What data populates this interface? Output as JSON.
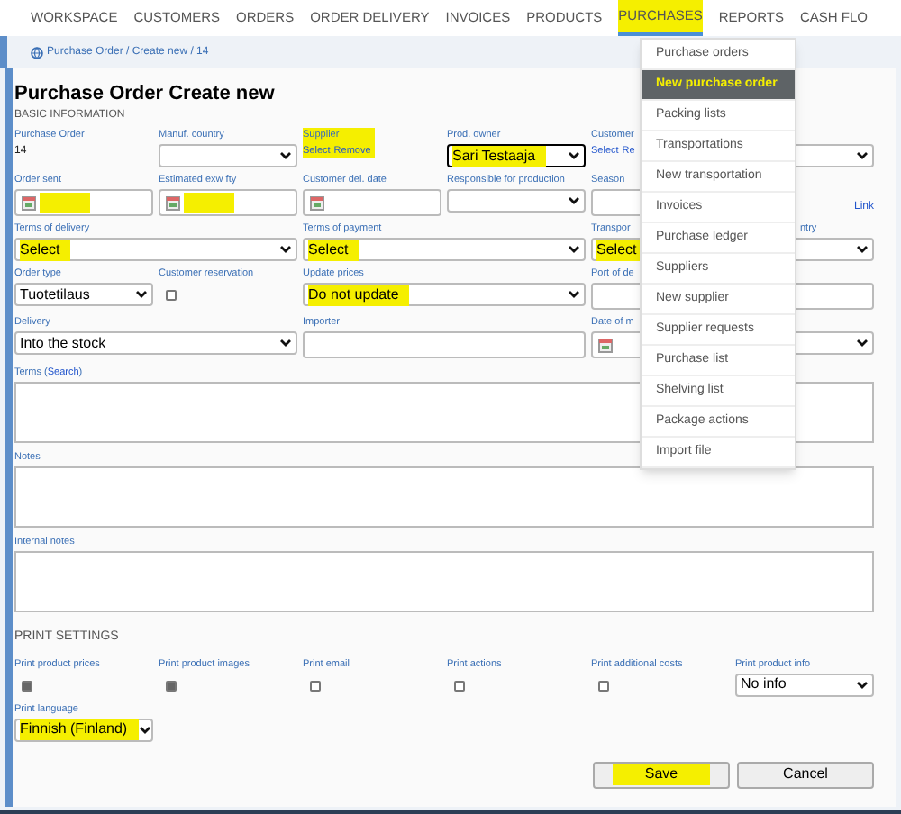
{
  "nav": [
    {
      "label": "WORKSPACE",
      "selected": false,
      "highlighted": false
    },
    {
      "label": "CUSTOMERS",
      "selected": false,
      "highlighted": false
    },
    {
      "label": "ORDERS",
      "selected": false,
      "highlighted": false
    },
    {
      "label": "ORDER DELIVERY",
      "selected": false,
      "highlighted": false
    },
    {
      "label": "INVOICES",
      "selected": false,
      "highlighted": false
    },
    {
      "label": "PRODUCTS",
      "selected": false,
      "highlighted": false
    },
    {
      "label": "PURCHASES",
      "selected": true,
      "highlighted": true
    },
    {
      "label": "REPORTS",
      "selected": false,
      "highlighted": false
    },
    {
      "label": "CASH FLO",
      "selected": false,
      "highlighted": false
    }
  ],
  "breadcrumb": "Purchase Order / Create new / 14",
  "title": "Purchase Order Create new",
  "section": "BASIC INFORMATION",
  "rows": [
    [
      {
        "kind": "static",
        "label": "Purchase Order",
        "value": "14"
      },
      {
        "kind": "select",
        "label": "Manuf. country"
      },
      {
        "kind": "links",
        "label": "Supplier",
        "links": [
          "Select",
          "Remove"
        ],
        "highlighted": true
      },
      {
        "kind": "select",
        "label": "Prod. owner",
        "value": "Sari Testaaja",
        "highlighted": true,
        "focused": true
      },
      {
        "kind": "links",
        "label": "Customer",
        "links": [
          "Select",
          "Re"
        ]
      },
      {
        "kind": "select"
      }
    ],
    [
      {
        "kind": "date",
        "label": "Order sent",
        "highlighted": true
      },
      {
        "kind": "date",
        "label": "Estimated exw fty",
        "highlighted": true
      },
      {
        "kind": "date",
        "label": "Customer del. date"
      },
      {
        "kind": "select",
        "label": "Responsible for production"
      },
      {
        "kind": "input",
        "label": "Season"
      },
      {
        "kind": "link",
        "value": "Link"
      }
    ],
    [
      {
        "kind": "select",
        "label": "Terms of delivery",
        "value": "Select",
        "highlighted": true
      },
      {
        "kind": "select",
        "label": "Terms of payment",
        "value": "Select",
        "highlighted": true
      },
      {
        "kind": "select",
        "label": "Transpor",
        "value": "Select",
        "highlighted": true
      },
      {
        "kind": "select",
        "label": "ntry"
      }
    ],
    [
      {
        "kind": "select",
        "label": "Order type",
        "value": "Tuotetilaus"
      },
      {
        "kind": "checkbox",
        "label": "Customer reservation",
        "checked": false
      },
      {
        "kind": "select",
        "label": "Update prices",
        "value": "Do not update",
        "highlighted": true
      },
      {
        "kind": "input",
        "label": "Port of de"
      }
    ],
    [
      {
        "kind": "select",
        "label": "Delivery",
        "value": "Into the stock"
      },
      {
        "kind": "input",
        "label": "Importer"
      },
      {
        "kind": "date",
        "label": "Date of m"
      },
      {
        "kind": "select"
      }
    ]
  ],
  "textareas": [
    {
      "label": "Terms (",
      "link": "Search",
      "label_end": ")"
    },
    {
      "label": "Notes"
    },
    {
      "label": "Internal notes"
    }
  ],
  "print_section": "PRINT SETTINGS",
  "print_options": [
    {
      "kind": "checkbox",
      "label": "Print product prices",
      "checked": true
    },
    {
      "kind": "checkbox",
      "label": "Print product images",
      "checked": true
    },
    {
      "kind": "checkbox",
      "label": "Print email",
      "checked": false
    },
    {
      "kind": "checkbox",
      "label": "Print actions",
      "checked": false
    },
    {
      "kind": "checkbox",
      "label": "Print additional costs",
      "checked": false
    },
    {
      "kind": "select",
      "label": "Print product info",
      "value": "No info"
    }
  ],
  "print_language": {
    "label": "Print language",
    "value": "Finnish (Finland)",
    "highlighted": true
  },
  "buttons": [
    {
      "label": "Save",
      "highlighted": true
    },
    {
      "label": "Cancel",
      "highlighted": false
    }
  ],
  "menu": [
    {
      "label": "Purchase orders",
      "selected": false
    },
    {
      "label": "New purchase order",
      "selected": true
    },
    {
      "label": "Packing lists",
      "selected": false
    },
    {
      "label": "Transportations",
      "selected": false
    },
    {
      "label": "New transportation",
      "selected": false
    },
    {
      "label": "Invoices",
      "selected": false
    },
    {
      "label": "Purchase ledger",
      "selected": false
    },
    {
      "label": "Suppliers",
      "selected": false
    },
    {
      "label": "New supplier",
      "selected": false
    },
    {
      "label": "Supplier requests",
      "selected": false
    },
    {
      "label": "Purchase list",
      "selected": false
    },
    {
      "label": "Shelving list",
      "selected": false
    },
    {
      "label": "Package actions",
      "selected": false
    },
    {
      "label": "Import file",
      "selected": false
    }
  ]
}
